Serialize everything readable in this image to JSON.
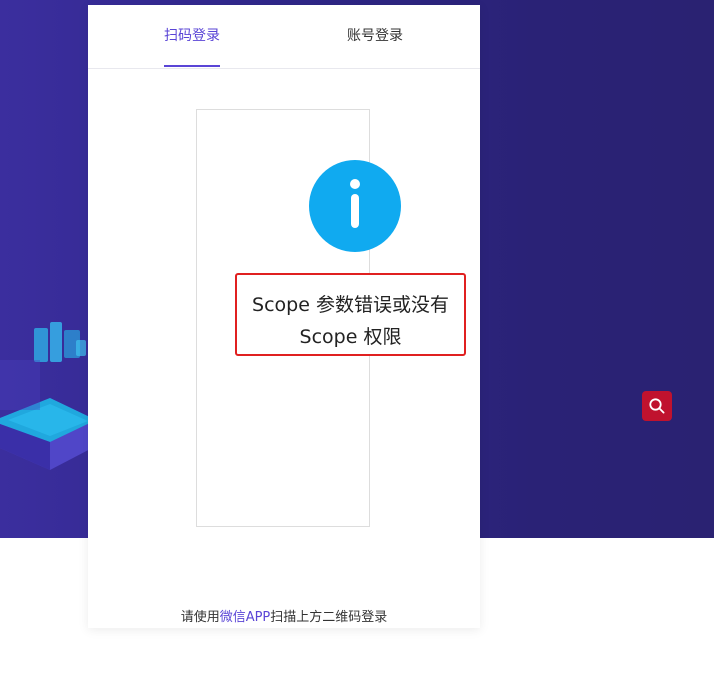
{
  "tabs": {
    "qr_login": "扫码登录",
    "account_login": "账号登录",
    "active": "qr_login"
  },
  "error": {
    "icon": "info-icon",
    "line1": "Scope 参数错误或没有",
    "line2": "Scope 权限"
  },
  "footer": {
    "prefix": "请使用",
    "link": "微信APP",
    "suffix": "扫描上方二维码登录"
  },
  "floating": {
    "search_icon": "search-icon"
  },
  "colors": {
    "hero_background": "#2f2789",
    "accent": "#5a45d6",
    "info_blue": "#10aaf0",
    "error_border": "#e02020",
    "search_button": "#c0122e"
  }
}
